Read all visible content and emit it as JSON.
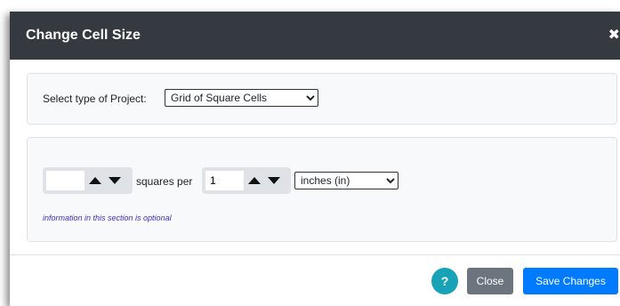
{
  "dialog": {
    "title": "Change Cell Size",
    "close_symbol": "✖"
  },
  "project": {
    "label": "Select type of Project:",
    "selected": "Grid of Square Cells"
  },
  "cell_size": {
    "count_value": "",
    "between_label": "squares per",
    "per_value": "1",
    "unit_selected": "inches (in)",
    "note": "information in this section is optional"
  },
  "footer": {
    "help_label": "?",
    "close_label": "Close",
    "save_label": "Save Changes"
  },
  "colors": {
    "header_bg": "#343a40",
    "section_bg": "#f8f9fa",
    "help": "#17a2b8",
    "close": "#6c757d",
    "save": "#007bff",
    "note": "#3b30c9"
  }
}
